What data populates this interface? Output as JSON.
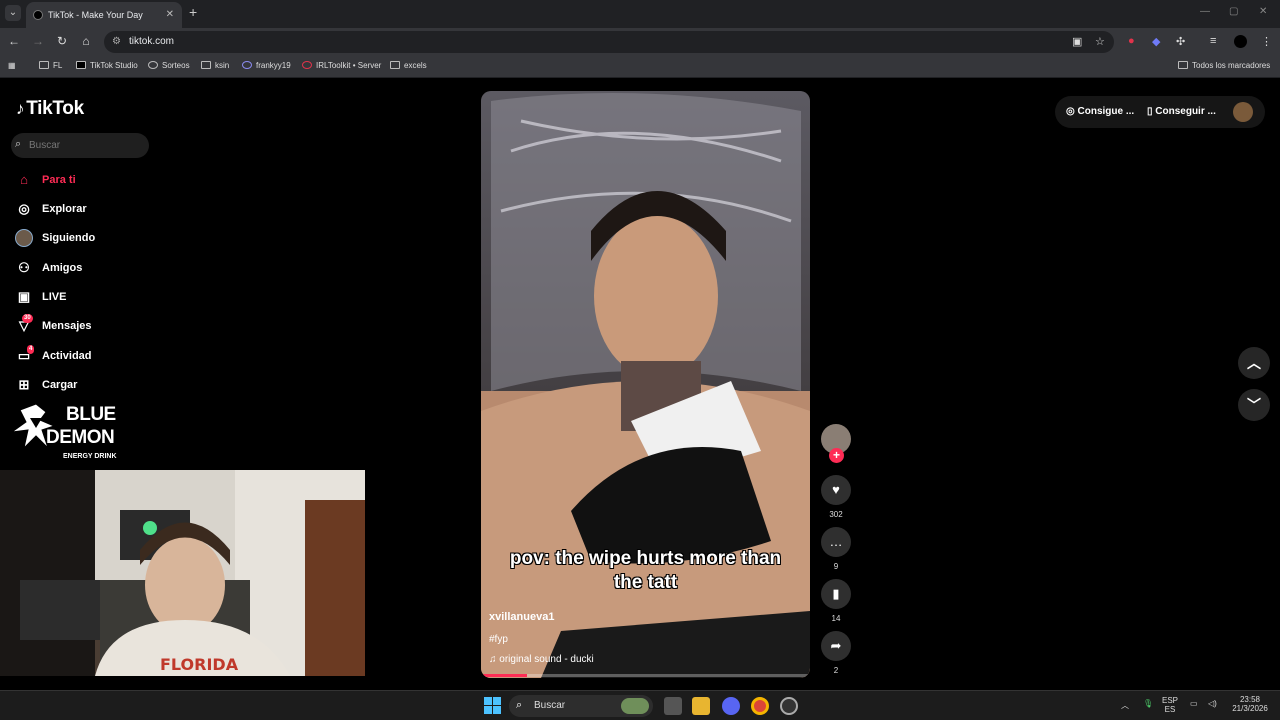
{
  "browser": {
    "tab_title": "TikTok - Make Your Day",
    "tab_close": "✕",
    "new_tab": "+",
    "url": "tiktok.com",
    "bookmarks": [
      "FL",
      "TikTok Studio",
      "Sorteos",
      "ksin",
      "frankyy19",
      "IRLToolkit • Server",
      "excels"
    ],
    "all_bookmarks": "Todos los marcadores"
  },
  "tiktok": {
    "logo": "TikTok",
    "search_placeholder": "Buscar",
    "nav": [
      {
        "label": "Para ti",
        "icon": "home-icon",
        "active": true
      },
      {
        "label": "Explorar",
        "icon": "compass-icon"
      },
      {
        "label": "Siguiendo",
        "icon": "following-avatar-icon"
      },
      {
        "label": "Amigos",
        "icon": "friends-icon"
      },
      {
        "label": "LIVE",
        "icon": "live-icon"
      },
      {
        "label": "Mensajes",
        "icon": "messages-icon",
        "badge": "30"
      },
      {
        "label": "Actividad",
        "icon": "activity-icon",
        "badge": "4"
      },
      {
        "label": "Cargar",
        "icon": "upload-icon"
      }
    ],
    "top_buttons": {
      "coins": "Consigue ...",
      "app": "Conseguir ..."
    },
    "video": {
      "caption_line1": "pov: the wipe hurts more than",
      "caption_line2": "the tatt",
      "author": "xvillanueva1",
      "hashtag": "#fyp",
      "sound": "original sound - ducki",
      "progress": 0.14
    },
    "actions": {
      "likes": "302",
      "comments": "9",
      "saves": "14",
      "shares": "2"
    }
  },
  "overlay": {
    "brand_line1": "BLUE",
    "brand_line2": "DEMON",
    "brand_line3": "ENERGY DRINK"
  },
  "taskbar": {
    "search": "Buscar",
    "lang_top": "ESP",
    "lang_bottom": "ES",
    "time": "23:58",
    "date": "21/3/2026"
  },
  "colors": {
    "accent": "#fe2c55",
    "chrome_dark": "#202124",
    "chrome_mid": "#35363a"
  }
}
